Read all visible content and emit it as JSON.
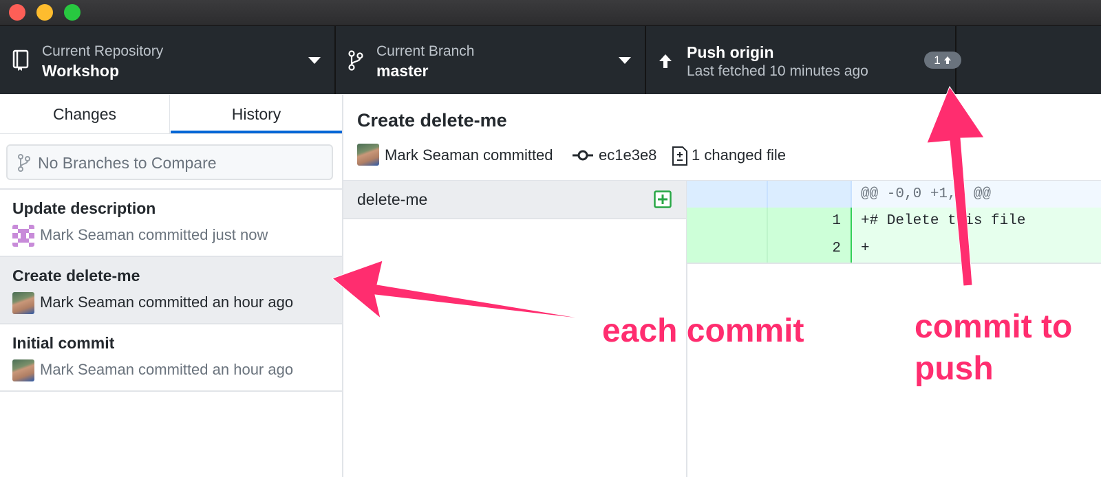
{
  "toolbar": {
    "repo_label": "Current Repository",
    "repo_name": "Workshop",
    "branch_label": "Current Branch",
    "branch_name": "master",
    "push_title": "Push origin",
    "push_sub": "Last fetched 10 minutes ago",
    "push_count": "1"
  },
  "sidebar": {
    "tabs": [
      "Changes",
      "History"
    ],
    "active_tab": "History",
    "compare_placeholder": "No Branches to Compare",
    "commits": [
      {
        "title": "Update description",
        "meta": "Mark Seaman committed just now"
      },
      {
        "title": "Create delete-me",
        "meta": "Mark Seaman committed an hour ago"
      },
      {
        "title": "Initial commit",
        "meta": "Mark Seaman committed an hour ago"
      }
    ]
  },
  "commit_detail": {
    "title": "Create delete-me",
    "author": "Mark Seaman committed",
    "sha": "ec1e3e8",
    "changed": "1 changed file"
  },
  "files": [
    {
      "name": "delete-me"
    }
  ],
  "diff": {
    "hunk": "@@ -0,0 +1,2 @@",
    "lines": [
      {
        "num": "1",
        "text": "+# Delete this file"
      },
      {
        "num": "2",
        "text": "+"
      }
    ]
  },
  "annotations": {
    "each_commit": "each commit",
    "commit_to_push_1": "commit to",
    "commit_to_push_2": "push"
  },
  "colors": {
    "accent": "#0366d6",
    "annotation": "#ff2d6f",
    "added_bg": "#e6ffed",
    "hunk_bg": "#f1f8ff"
  }
}
